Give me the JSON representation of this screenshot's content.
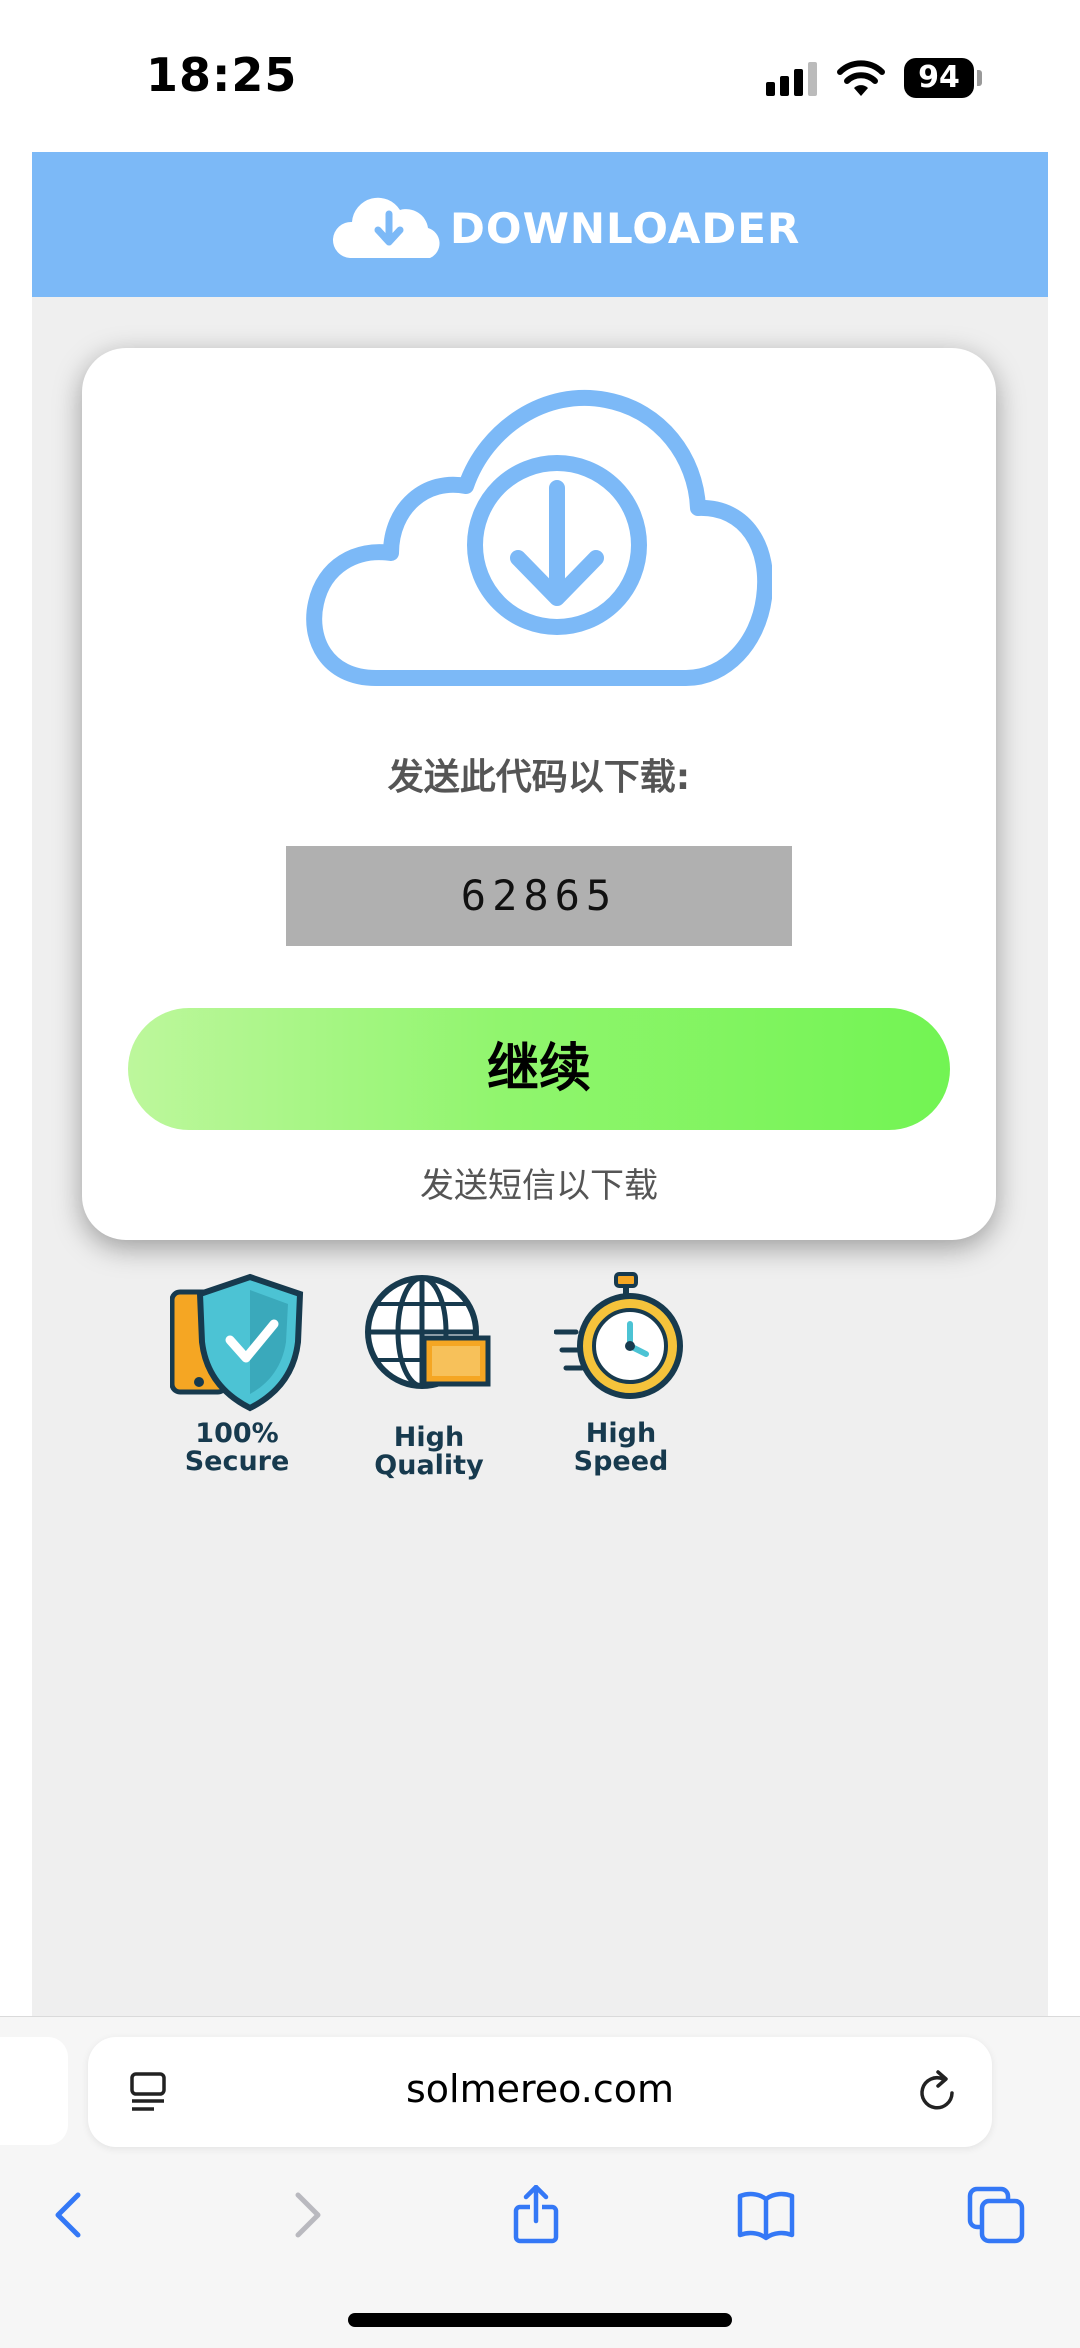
{
  "status_bar": {
    "time": "18:25",
    "battery": "94"
  },
  "header": {
    "logo_text": "DOWNLOADER"
  },
  "card": {
    "instruction": "发送此代码以下载:",
    "code": "62865",
    "continue_label": "继续",
    "sms_text": "发送短信以下载"
  },
  "features": [
    {
      "line1": "100%",
      "line2": "Secure",
      "icon": "shield-phone-icon"
    },
    {
      "line1": "High",
      "line2": "Quality",
      "icon": "globe-hd-icon"
    },
    {
      "line1": "High",
      "line2": "Speed",
      "icon": "stopwatch-icon"
    }
  ],
  "browser": {
    "url": "solmereo.com"
  },
  "colors": {
    "header": "#7cb9f7",
    "button_start": "#bdf79c",
    "button_end": "#72f453",
    "code_box": "#b0b0b0",
    "ios_blue": "#3478f6"
  }
}
